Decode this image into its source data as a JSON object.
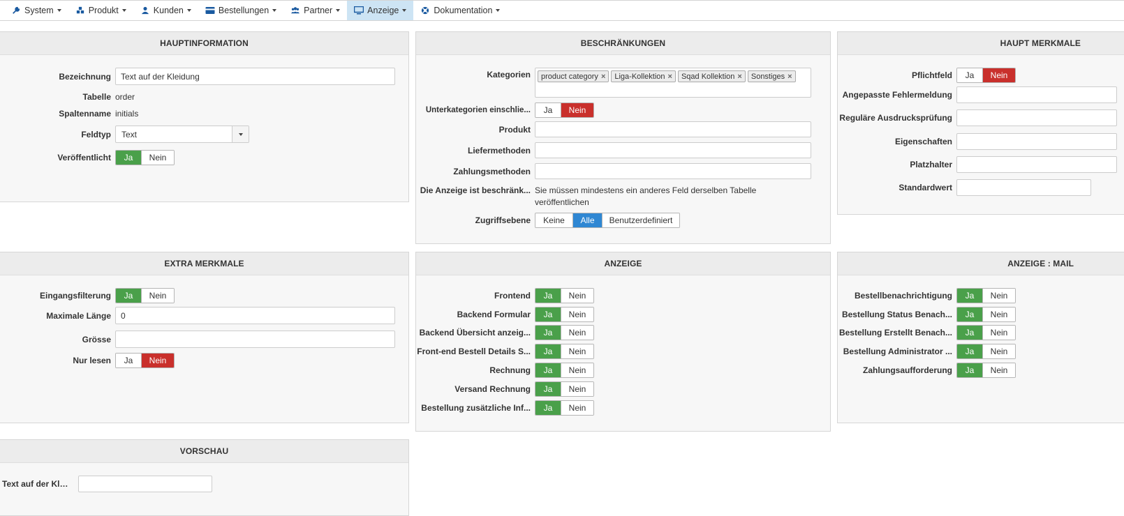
{
  "nav": [
    {
      "label": "System",
      "icon": "wrench-icon"
    },
    {
      "label": "Produkt",
      "icon": "cubes-icon"
    },
    {
      "label": "Kunden",
      "icon": "user-icon"
    },
    {
      "label": "Bestellungen",
      "icon": "credit-card-icon"
    },
    {
      "label": "Partner",
      "icon": "users-icon"
    },
    {
      "label": "Anzeige",
      "icon": "monitor-icon",
      "active": true
    },
    {
      "label": "Dokumentation",
      "icon": "lifebuoy-icon"
    }
  ],
  "colors": {
    "green": "#4aa04a",
    "red": "#c9302c",
    "blue": "#2f87d3",
    "nav_active": "#cde4f4"
  },
  "toggle": {
    "yes": "Ja",
    "no": "Nein"
  },
  "hauptinfo": {
    "title": "HAUPTINFORMATION",
    "bezeichnung_label": "Bezeichnung",
    "bezeichnung_value": "Text auf der Kleidung",
    "tabelle_label": "Tabelle",
    "tabelle_value": "order",
    "spaltenname_label": "Spaltenname",
    "spaltenname_value": "initials",
    "feldtyp_label": "Feldtyp",
    "feldtyp_value": "Text",
    "veroeffentlicht_label": "Veröffentlicht",
    "veroeffentlicht_state": "Ja"
  },
  "beschraenkungen": {
    "title": "BESCHRÄNKUNGEN",
    "kategorien_label": "Kategorien",
    "kategorien": [
      "product category",
      "Liga-Kollektion",
      "Sqad Kollektion",
      "Sonstiges"
    ],
    "unterkategorien_label": "Unterkategorien einschlie...",
    "unterkategorien_state": "Nein",
    "produkt_label": "Produkt",
    "liefermethoden_label": "Liefermethoden",
    "zahlungsmethoden_label": "Zahlungsmethoden",
    "anzeige_beschraenkt_label": "Die Anzeige ist beschränk...",
    "anzeige_beschraenkt_note": "Sie müssen mindestens ein anderes Feld derselben Tabelle veröffentlichen",
    "zugriffsebene_label": "Zugriffsebene",
    "zugriffsebene_options": [
      "Keine",
      "Alle",
      "Benutzerdefiniert"
    ],
    "zugriffsebene_selected": "Alle"
  },
  "haupt_merkmale": {
    "title": "HAUPT MERKMALE",
    "pflichtfeld_label": "Pflichtfeld",
    "pflichtfeld_state": "Nein",
    "fehlermeldung_label": "Angepasste Fehlermeldung",
    "regex_label": "Reguläre Ausdrucksprüfung",
    "eigenschaften_label": "Eigenschaften",
    "platzhalter_label": "Platzhalter",
    "standardwert_label": "Standardwert"
  },
  "extra_merkmale": {
    "title": "EXTRA MERKMALE",
    "eingangsfilterung_label": "Eingangsfilterung",
    "eingangsfilterung_state": "Ja",
    "max_laenge_label": "Maximale Länge",
    "max_laenge_value": "0",
    "groesse_label": "Grösse",
    "nur_lesen_label": "Nur lesen",
    "nur_lesen_state": "Nein"
  },
  "anzeige": {
    "title": "ANZEIGE",
    "items": [
      {
        "label": "Frontend",
        "state": "Ja"
      },
      {
        "label": "Backend Formular",
        "state": "Ja"
      },
      {
        "label": "Backend Übersicht anzeig...",
        "state": "Ja"
      },
      {
        "label": "Front-end Bestell Details S...",
        "state": "Ja"
      },
      {
        "label": "Rechnung",
        "state": "Ja"
      },
      {
        "label": "Versand Rechnung",
        "state": "Ja"
      },
      {
        "label": "Bestellung zusätzliche Inf...",
        "state": "Ja"
      }
    ]
  },
  "anzeige_mail": {
    "title": "ANZEIGE : MAIL",
    "items": [
      {
        "label": "Bestellbenachrichtigung",
        "state": "Ja"
      },
      {
        "label": "Bestellung Status Benach...",
        "state": "Ja"
      },
      {
        "label": "Bestellung Erstellt Benach...",
        "state": "Ja"
      },
      {
        "label": "Bestellung Administrator ...",
        "state": "Ja"
      },
      {
        "label": "Zahlungsaufforderung",
        "state": "Ja"
      }
    ]
  },
  "vorschau": {
    "title": "VORSCHAU",
    "field_label": "Text auf der Klei..."
  }
}
